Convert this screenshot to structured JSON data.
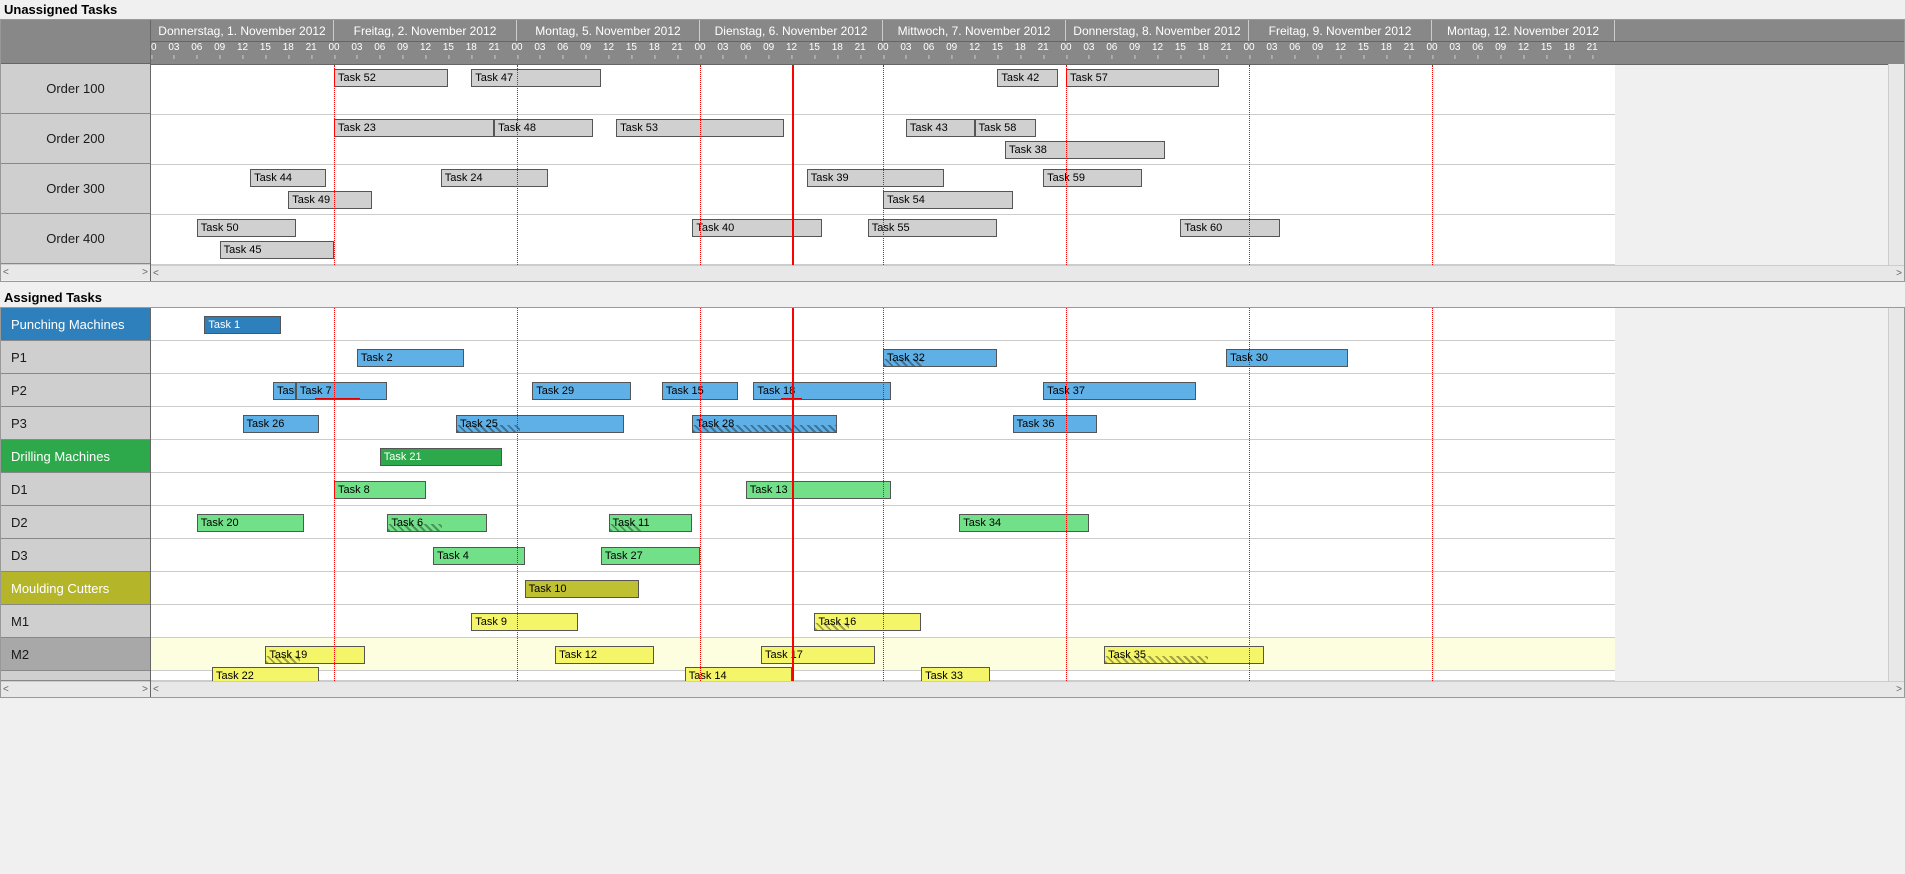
{
  "layout": {
    "leftWidth": 150,
    "dayWidth": 183,
    "hourInterval": 3,
    "headerHeight": 44,
    "unassignedRowHeight": 50,
    "assignedRowHeight": 33
  },
  "timeline": {
    "days": [
      "Donnerstag, 1. November 2012",
      "Freitag, 2. November 2012",
      "Montag, 5. November 2012",
      "Dienstag, 6. November 2012",
      "Mittwoch, 7. November 2012",
      "Donnerstag, 8. November 2012",
      "Freitag, 9. November 2012",
      "Montag, 12. November 2012"
    ],
    "nowDay": 3,
    "nowHour": 12,
    "boundaryHours": [
      0,
      24
    ]
  },
  "unassigned": {
    "title": "Unassigned Tasks",
    "rows": [
      {
        "label": "Order 100",
        "tasks": [
          {
            "label": "Task 52",
            "day": 1,
            "hour": 0,
            "dur": 15,
            "sub": 0
          },
          {
            "label": "Task 47",
            "day": 1,
            "hour": 18,
            "dur": 17,
            "sub": 0
          },
          {
            "label": "Task 42",
            "day": 4,
            "hour": 15,
            "dur": 8,
            "sub": 0
          },
          {
            "label": "Task 57",
            "day": 5,
            "hour": 0,
            "dur": 20,
            "sub": 0
          }
        ]
      },
      {
        "label": "Order 200",
        "tasks": [
          {
            "label": "Task 23",
            "day": 1,
            "hour": 0,
            "dur": 21,
            "sub": 0
          },
          {
            "label": "Task 48",
            "day": 1,
            "hour": 21,
            "dur": 13,
            "sub": 0
          },
          {
            "label": "Task 53",
            "day": 2,
            "hour": 13,
            "dur": 22,
            "sub": 0
          },
          {
            "label": "Task 43",
            "day": 4,
            "hour": 3,
            "dur": 9,
            "sub": 0
          },
          {
            "label": "Task 58",
            "day": 4,
            "hour": 12,
            "dur": 8,
            "sub": 0
          },
          {
            "label": "Task 38",
            "day": 4,
            "hour": 16,
            "dur": 21,
            "sub": 1
          }
        ]
      },
      {
        "label": "Order 300",
        "tasks": [
          {
            "label": "Task 44",
            "day": 0,
            "hour": 13,
            "dur": 10,
            "sub": 0
          },
          {
            "label": "Task 49",
            "day": 0,
            "hour": 18,
            "dur": 11,
            "sub": 1
          },
          {
            "label": "Task 24",
            "day": 1,
            "hour": 14,
            "dur": 14,
            "sub": 0
          },
          {
            "label": "Task 39",
            "day": 3,
            "hour": 14,
            "dur": 18,
            "sub": 0
          },
          {
            "label": "Task 54",
            "day": 4,
            "hour": 0,
            "dur": 17,
            "sub": 1
          },
          {
            "label": "Task 59",
            "day": 4,
            "hour": 21,
            "dur": 13,
            "sub": 0
          }
        ]
      },
      {
        "label": "Order 400",
        "tasks": [
          {
            "label": "Task 50",
            "day": 0,
            "hour": 6,
            "dur": 13,
            "sub": 0
          },
          {
            "label": "Task 45",
            "day": 0,
            "hour": 9,
            "dur": 15,
            "sub": 1
          },
          {
            "label": "Task 40",
            "day": 2,
            "hour": 23,
            "dur": 17,
            "sub": 0
          },
          {
            "label": "Task 55",
            "day": 3,
            "hour": 22,
            "dur": 17,
            "sub": 0
          },
          {
            "label": "Task 60",
            "day": 5,
            "hour": 15,
            "dur": 13,
            "sub": 0
          }
        ]
      }
    ]
  },
  "assigned": {
    "title": "Assigned Tasks",
    "rows": [
      {
        "label": "Punching Machines",
        "type": "category",
        "bg": "#2e80bd",
        "tasks": [
          {
            "label": "Task 1",
            "day": 0,
            "hour": 7,
            "dur": 10,
            "color": "blue-dark"
          }
        ]
      },
      {
        "label": "P1",
        "type": "resource",
        "tasks": [
          {
            "label": "Task 2",
            "day": 1,
            "hour": 3,
            "dur": 14,
            "color": "blue"
          },
          {
            "label": "Task 32",
            "day": 4,
            "hour": 0,
            "dur": 15,
            "color": "blue",
            "hatch": 0.35
          },
          {
            "label": "Task 30",
            "day": 5,
            "hour": 21,
            "dur": 16,
            "color": "blue"
          }
        ]
      },
      {
        "label": "P2",
        "type": "resource",
        "tasks": [
          {
            "label": "Task 3",
            "day": 0,
            "hour": 16,
            "dur": 3,
            "color": "blue"
          },
          {
            "label": "Task 7",
            "day": 0,
            "hour": 19,
            "dur": 12,
            "color": "blue",
            "underline": [
              0.2,
              0.7
            ]
          },
          {
            "label": "Task 29",
            "day": 2,
            "hour": 2,
            "dur": 13,
            "color": "blue"
          },
          {
            "label": "Task 15",
            "day": 2,
            "hour": 19,
            "dur": 10,
            "color": "blue"
          },
          {
            "label": "Task 18",
            "day": 3,
            "hour": 7,
            "dur": 18,
            "color": "blue",
            "underline": [
              0.2,
              0.35
            ]
          },
          {
            "label": "Task 37",
            "day": 4,
            "hour": 21,
            "dur": 20,
            "color": "blue"
          }
        ]
      },
      {
        "label": "P3",
        "type": "resource",
        "tasks": [
          {
            "label": "Task 26",
            "day": 0,
            "hour": 12,
            "dur": 10,
            "color": "blue"
          },
          {
            "label": "Task 25",
            "day": 1,
            "hour": 16,
            "dur": 22,
            "color": "blue",
            "hatch": 0.38
          },
          {
            "label": "Task 28",
            "day": 2,
            "hour": 23,
            "dur": 19,
            "color": "blue",
            "hatch": 1.0
          },
          {
            "label": "Task 36",
            "day": 4,
            "hour": 17,
            "dur": 11,
            "color": "blue"
          }
        ]
      },
      {
        "label": "Drilling Machines",
        "type": "category",
        "bg": "#2da94b",
        "tasks": [
          {
            "label": "Task 21",
            "day": 1,
            "hour": 6,
            "dur": 16,
            "color": "green-dark"
          }
        ]
      },
      {
        "label": "D1",
        "type": "resource",
        "tasks": [
          {
            "label": "Task 8",
            "day": 1,
            "hour": 0,
            "dur": 12,
            "color": "green"
          },
          {
            "label": "Task 13",
            "day": 3,
            "hour": 6,
            "dur": 19,
            "color": "green"
          }
        ]
      },
      {
        "label": "D2",
        "type": "resource",
        "tasks": [
          {
            "label": "Task 20",
            "day": 0,
            "hour": 6,
            "dur": 14,
            "color": "green"
          },
          {
            "label": "Task 6",
            "day": 1,
            "hour": 7,
            "dur": 13,
            "color": "green",
            "hatch": 0.55
          },
          {
            "label": "Task 11",
            "day": 2,
            "hour": 12,
            "dur": 11,
            "color": "green",
            "hatch": 0.38
          },
          {
            "label": "Task 34",
            "day": 4,
            "hour": 10,
            "dur": 17,
            "color": "green"
          }
        ]
      },
      {
        "label": "D3",
        "type": "resource",
        "tasks": [
          {
            "label": "Task 4",
            "day": 1,
            "hour": 13,
            "dur": 12,
            "color": "green"
          },
          {
            "label": "Task 27",
            "day": 2,
            "hour": 11,
            "dur": 13,
            "color": "green"
          }
        ]
      },
      {
        "label": "Moulding Cutters",
        "type": "category",
        "bg": "#b5b52a",
        "tasks": [
          {
            "label": "Task 10",
            "day": 2,
            "hour": 1,
            "dur": 15,
            "color": "olive"
          }
        ]
      },
      {
        "label": "M1",
        "type": "resource",
        "tasks": [
          {
            "label": "Task 9",
            "day": 1,
            "hour": 18,
            "dur": 14,
            "color": "yellow"
          },
          {
            "label": "Task 16",
            "day": 3,
            "hour": 15,
            "dur": 14,
            "color": "yellow",
            "hatch": 0.32
          }
        ]
      },
      {
        "label": "M2",
        "type": "resource",
        "highlight": true,
        "tasks": [
          {
            "label": "Task 19",
            "day": 0,
            "hour": 15,
            "dur": 13,
            "color": "yellow",
            "hatch": 0.35
          },
          {
            "label": "Task 12",
            "day": 2,
            "hour": 5,
            "dur": 13,
            "color": "yellow"
          },
          {
            "label": "Task 17",
            "day": 3,
            "hour": 8,
            "dur": 15,
            "color": "yellow"
          },
          {
            "label": "Task 35",
            "day": 5,
            "hour": 5,
            "dur": 21,
            "color": "yellow",
            "hatch": 0.65
          }
        ]
      },
      {
        "label": "",
        "type": "resource",
        "clip": true,
        "tasks": [
          {
            "label": "Task 22",
            "day": 0,
            "hour": 8,
            "dur": 14,
            "color": "yellow"
          },
          {
            "label": "Task 14",
            "day": 2,
            "hour": 22,
            "dur": 14,
            "color": "yellow"
          },
          {
            "label": "Task 33",
            "day": 4,
            "hour": 5,
            "dur": 9,
            "color": "yellow"
          }
        ]
      }
    ]
  }
}
